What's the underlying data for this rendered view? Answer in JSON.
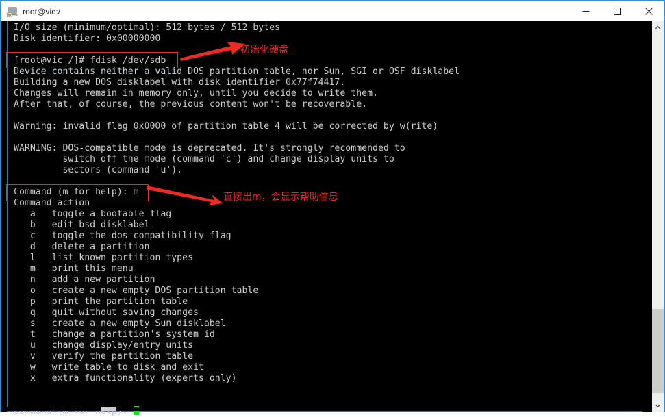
{
  "window": {
    "title": "root@vic:/",
    "icon": "terminal-shortcut-icon",
    "controls": {
      "minimize_label": "Minimize",
      "maximize_label": "Maximize",
      "close_label": "Close"
    },
    "border_color": "#2b8fd8"
  },
  "terminal": {
    "background": "#000000",
    "foreground": "#cdcdcd",
    "cursor_color": "#00ee00",
    "lines": [
      "I/O size (minimum/optimal): 512 bytes / 512 bytes",
      "Disk identifier: 0x00000000",
      "",
      "[root@vic /]# fdisk /dev/sdb",
      "Device contains neither a valid DOS partition table, nor Sun, SGI or OSF disklabel",
      "Building a new DOS disklabel with disk identifier 0x77f74417.",
      "Changes will remain in memory only, until you decide to write them.",
      "After that, of course, the previous content won't be recoverable.",
      "",
      "Warning: invalid flag 0x0000 of partition table 4 will be corrected by w(rite)",
      "",
      "WARNING: DOS-compatible mode is deprecated. It's strongly recommended to",
      "         switch off the mode (command 'c') and change display units to",
      "         sectors (command 'u').",
      "",
      "Command (m for help): m",
      "Command action",
      "   a   toggle a bootable flag",
      "   b   edit bsd disklabel",
      "   c   toggle the dos compatibility flag",
      "   d   delete a partition",
      "   l   list known partition types",
      "   m   print this menu",
      "   n   add a new partition",
      "   o   create a new empty DOS partition table",
      "   p   print the partition table",
      "   q   quit without saving changes",
      "   s   create a new empty Sun disklabel",
      "   t   change a partition's system id",
      "   u   change display/entry units",
      "   v   verify the partition table",
      "   w   write table to disk and exit",
      "   x   extra functionality (experts only)",
      "",
      ""
    ],
    "prompt_line": "Command (m for help): "
  },
  "annotations": {
    "color": "#ee2a22",
    "items": [
      {
        "label": "初始化硬盘",
        "target": "[root@vic /]# fdisk /dev/sdb"
      },
      {
        "label": "直接出m，会显示帮助信息",
        "target": "Command (m for help): m"
      }
    ]
  },
  "scrollbars": {
    "vertical": {
      "up_icon": "chevron-up-icon",
      "down_icon": "chevron-down-icon"
    },
    "horizontal": {
      "present": true
    }
  }
}
